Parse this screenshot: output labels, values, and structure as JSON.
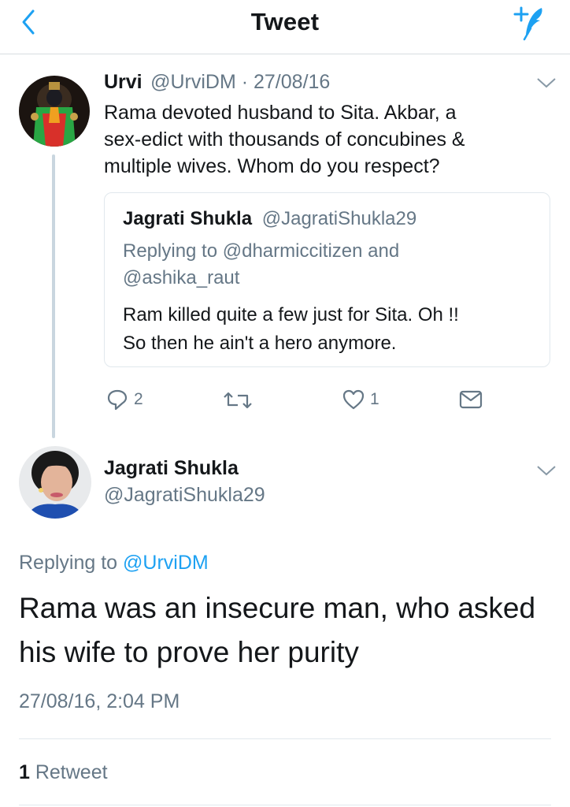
{
  "header": {
    "title": "Tweet"
  },
  "icons": {
    "back": "chevron-left-icon",
    "compose": "compose-tweet-icon",
    "reply": "reply-icon",
    "retweet": "retweet-icon",
    "like": "heart-icon",
    "dm": "envelope-icon",
    "more": "chevron-down-icon"
  },
  "colors": {
    "accent": "#1da1f2",
    "text": "#14171a",
    "muted": "#657786",
    "divider": "#e1e8ed"
  },
  "parent_tweet": {
    "display_name": "Urvi",
    "meta": "@UrviDM · 27/08/16",
    "lines": [
      "Rama devoted husband to Sita. Akbar, a",
      "sex-edict with thousands of concubines &",
      "multiple wives. Whom do you respect?"
    ],
    "quoted": {
      "display_name": "Jagrati Shukla",
      "handle": "@JagratiShukla29",
      "replying_lines": [
        "Replying to @dharmiccitizen and",
        "@ashika_raut"
      ],
      "lines": [
        "Ram killed quite a few just for Sita. Oh !!",
        "So then he ain't a hero anymore."
      ]
    },
    "actions": {
      "reply_count": "2",
      "like_count": "1"
    }
  },
  "main_tweet": {
    "display_name": "Jagrati Shukla",
    "handle": "@JagratiShukla29",
    "replying_prefix": "Replying to ",
    "replying_to": "@UrviDM",
    "lines": [
      "Rama was an insecure man, who asked",
      "his wife to prove her purity"
    ],
    "timestamp": "27/08/16, 2:04 PM",
    "retweet_count": "1",
    "retweet_label": " Retweet"
  }
}
